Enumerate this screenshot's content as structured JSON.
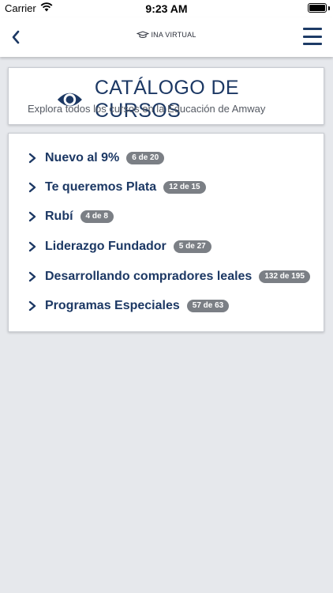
{
  "status_bar": {
    "carrier": "Carrier",
    "time": "9:23 AM"
  },
  "nav": {
    "logo_text": "INA VIRTUAL"
  },
  "catalog": {
    "title": "CATÁLOGO DE CURSOS",
    "subtitle": "Explora todos los cursos en la Educación de Amway"
  },
  "courses": [
    {
      "label": "Nuevo al 9%",
      "progress": "6 de 20"
    },
    {
      "label": "Te queremos Plata",
      "progress": "12 de 15"
    },
    {
      "label": "Rubí",
      "progress": "4 de 8"
    },
    {
      "label": "Liderazgo Fundador",
      "progress": "5 de 27"
    },
    {
      "label": "Desarrollando compradores leales",
      "progress": "132 de 195"
    },
    {
      "label": "Programas Especiales",
      "progress": "57 de 63"
    }
  ],
  "colors": {
    "brand_navy": "#1c3864",
    "badge_gray": "#7b7f85",
    "page_bg": "#e6e8ec"
  }
}
